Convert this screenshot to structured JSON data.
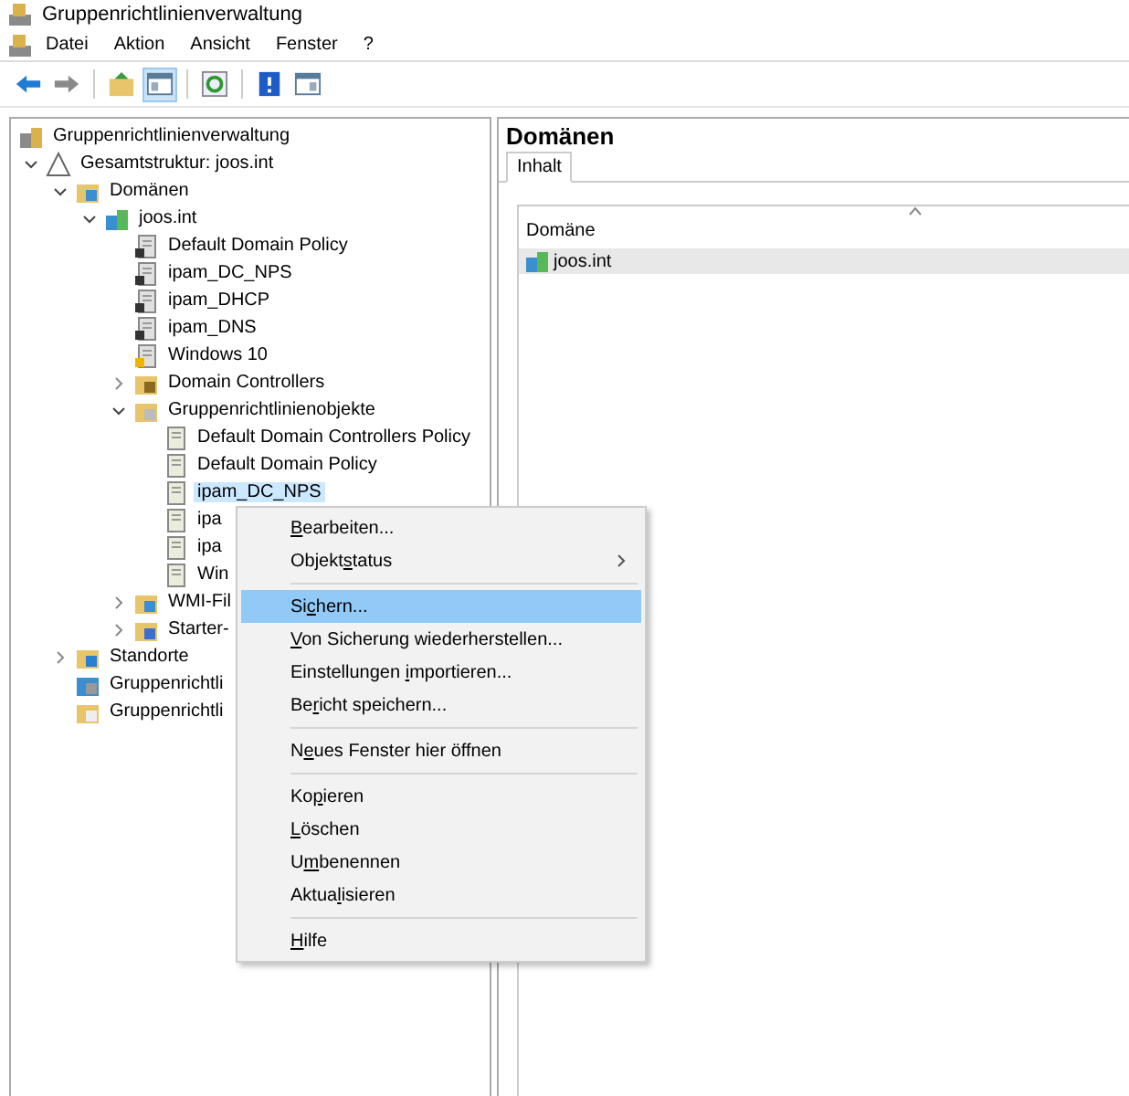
{
  "window": {
    "title": "Gruppenrichtlinienverwaltung"
  },
  "menubar": [
    "Datei",
    "Aktion",
    "Ansicht",
    "Fenster",
    "?"
  ],
  "toolbar": [
    {
      "kind": "back",
      "pressed": false
    },
    {
      "kind": "forward",
      "pressed": false
    },
    {
      "kind": "sep"
    },
    {
      "kind": "up",
      "pressed": false
    },
    {
      "kind": "tree",
      "pressed": true
    },
    {
      "kind": "sep"
    },
    {
      "kind": "refresh",
      "pressed": false
    },
    {
      "kind": "sep"
    },
    {
      "kind": "help",
      "pressed": false
    },
    {
      "kind": "pane",
      "pressed": false
    }
  ],
  "tree": [
    {
      "label": "Gruppenrichtlinienverwaltung",
      "kind": "console",
      "selected": false,
      "children": [
        {
          "label": "Gesamtstruktur: joos.int",
          "kind": "forest",
          "selected": false,
          "expanded": true,
          "children": [
            {
              "label": "Domänen",
              "kind": "domains",
              "selected": false,
              "expanded": true,
              "children": [
                {
                  "label": "joos.int",
                  "kind": "domain",
                  "selected": false,
                  "expanded": true,
                  "children": [
                    {
                      "label": "Default Domain Policy",
                      "kind": "link",
                      "selected": false
                    },
                    {
                      "label": "ipam_DC_NPS",
                      "kind": "link",
                      "selected": false
                    },
                    {
                      "label": "ipam_DHCP",
                      "kind": "link",
                      "selected": false
                    },
                    {
                      "label": "ipam_DNS",
                      "kind": "link",
                      "selected": false
                    },
                    {
                      "label": "Windows 10",
                      "kind": "link-warn",
                      "selected": false
                    },
                    {
                      "label": "Domain Controllers",
                      "kind": "ou",
                      "selected": false,
                      "expanded": false
                    },
                    {
                      "label": "Gruppenrichtlinienobjekte",
                      "kind": "gpo-folder",
                      "selected": false,
                      "expanded": true,
                      "children": [
                        {
                          "label": "Default Domain Controllers Policy",
                          "kind": "gpo",
                          "selected": false
                        },
                        {
                          "label": "Default Domain Policy",
                          "kind": "gpo",
                          "selected": false
                        },
                        {
                          "label": "ipam_DC_NPS",
                          "kind": "gpo",
                          "selected": true
                        },
                        {
                          "label": "ipa",
                          "kind": "gpo",
                          "selected": false
                        },
                        {
                          "label": "ipa",
                          "kind": "gpo",
                          "selected": false
                        },
                        {
                          "label": "Win",
                          "kind": "gpo",
                          "selected": false
                        }
                      ]
                    },
                    {
                      "label": "WMI-Fil",
                      "kind": "wmi",
                      "selected": false,
                      "expanded": false
                    },
                    {
                      "label": "Starter-",
                      "kind": "starter",
                      "selected": false,
                      "expanded": false
                    }
                  ]
                }
              ]
            },
            {
              "label": "Standorte",
              "kind": "sites",
              "selected": false,
              "expanded": false
            },
            {
              "label": "Gruppenrichtli",
              "kind": "modeling",
              "selected": false
            },
            {
              "label": "Gruppenrichtli",
              "kind": "results",
              "selected": false
            }
          ]
        }
      ]
    }
  ],
  "details": {
    "title": "Domänen",
    "tabs": [
      {
        "label": "Inhalt",
        "selected": true
      }
    ],
    "column": "Domäne",
    "rows": [
      {
        "label": "joos.int",
        "selected": true
      }
    ]
  },
  "context_menu": [
    {
      "kind": "item",
      "label": {
        "key": "B",
        "post": "earbeiten..."
      },
      "selected": false
    },
    {
      "kind": "submenu",
      "label": {
        "pre": "Objekt",
        "key": "s",
        "post": "tatus"
      },
      "selected": false
    },
    {
      "kind": "sep"
    },
    {
      "kind": "item",
      "label": {
        "pre": "Si",
        "key": "c",
        "post": "hern..."
      },
      "selected": true
    },
    {
      "kind": "item",
      "label": {
        "key": "V",
        "post": "on Sicherung wiederherstellen..."
      },
      "selected": false
    },
    {
      "kind": "item",
      "label": {
        "pre": "Einstellungen ",
        "key": "i",
        "post": "mportieren..."
      },
      "selected": false
    },
    {
      "kind": "item",
      "label": {
        "pre": "Be",
        "key": "r",
        "post": "icht speichern..."
      },
      "selected": false
    },
    {
      "kind": "sep"
    },
    {
      "kind": "item",
      "label": {
        "pre": "N",
        "key": "e",
        "post": "ues Fenster hier öffnen"
      },
      "selected": false
    },
    {
      "kind": "sep"
    },
    {
      "kind": "item",
      "label": {
        "pre": "Ko",
        "key": "p",
        "post": "ieren"
      },
      "selected": false
    },
    {
      "kind": "item",
      "label": {
        "key": "L",
        "post": "öschen"
      },
      "selected": false
    },
    {
      "kind": "item",
      "label": {
        "pre": "U",
        "key": "m",
        "post": "benennen"
      },
      "selected": false
    },
    {
      "kind": "item",
      "label": {
        "pre": "Aktua",
        "key": "l",
        "post": "isieren"
      },
      "selected": false
    },
    {
      "kind": "sep"
    },
    {
      "kind": "item",
      "label": {
        "key": "H",
        "post": "ilfe"
      },
      "selected": false
    }
  ]
}
